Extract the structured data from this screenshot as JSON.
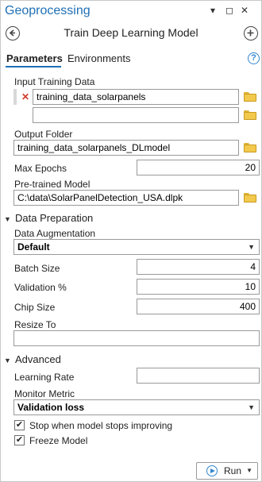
{
  "window": {
    "title": "Geoprocessing",
    "controls": [
      "▾",
      "◻",
      "✕"
    ]
  },
  "tool": {
    "title": "Train Deep Learning Model",
    "back_icon": "back-arrow-icon",
    "add_icon": "add-icon"
  },
  "tabs": [
    {
      "label": "Parameters",
      "active": true
    },
    {
      "label": "Environments",
      "active": false
    }
  ],
  "help_glyph": "?",
  "params": {
    "input_training_data": {
      "label": "Input Training Data",
      "rows": [
        "training_data_solarpanels",
        ""
      ]
    },
    "output_folder": {
      "label": "Output Folder",
      "value": "training_data_solarpanels_DLmodel"
    },
    "max_epochs": {
      "label": "Max Epochs",
      "value": "20"
    },
    "pretrained_model": {
      "label": "Pre-trained Model",
      "value": "C:\\data\\SolarPanelDetection_USA.dlpk"
    }
  },
  "data_prep": {
    "title": "Data Preparation",
    "augmentation": {
      "label": "Data Augmentation",
      "value": "Default"
    },
    "batch_size": {
      "label": "Batch Size",
      "value": "4"
    },
    "validation": {
      "label": "Validation %",
      "value": "10"
    },
    "chip_size": {
      "label": "Chip Size",
      "value": "400"
    },
    "resize_to": {
      "label": "Resize To",
      "value": ""
    }
  },
  "advanced": {
    "title": "Advanced",
    "learning_rate": {
      "label": "Learning Rate",
      "value": ""
    },
    "monitor_metric": {
      "label": "Monitor Metric",
      "value": "Validation loss"
    },
    "stop_improving": {
      "label": "Stop when model stops improving",
      "checked": true
    },
    "freeze_model": {
      "label": "Freeze Model",
      "checked": true
    }
  },
  "run": {
    "label": "Run"
  },
  "colors": {
    "accent": "#1f6fb5",
    "folder": "#f2c94c",
    "error": "#d13a2a"
  }
}
